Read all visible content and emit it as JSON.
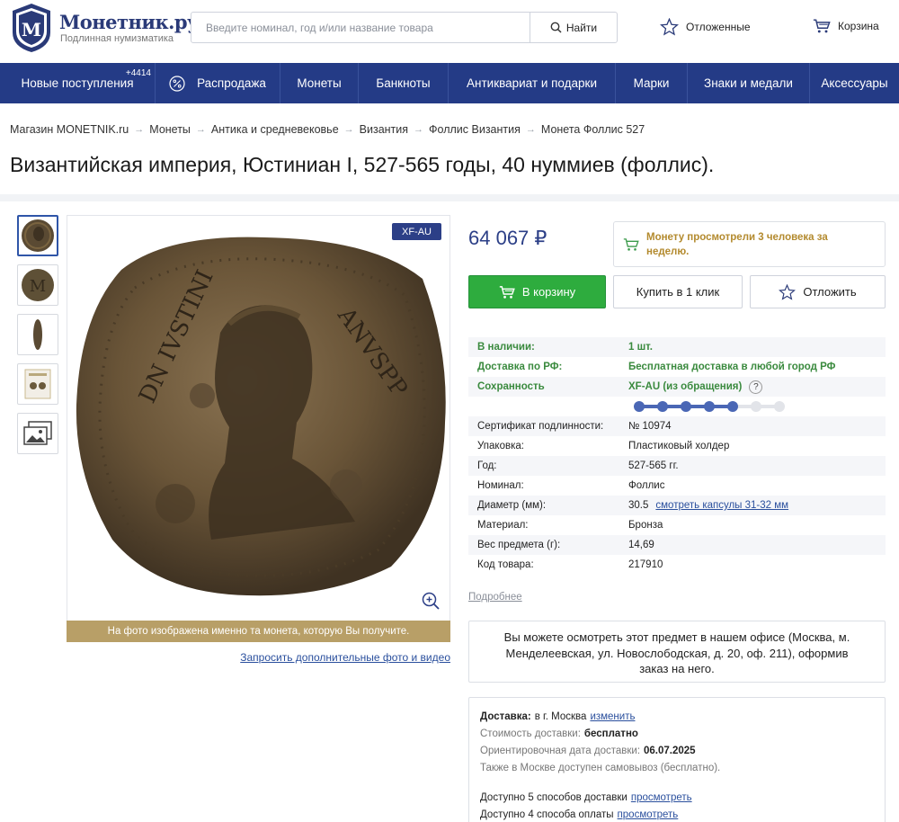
{
  "header": {
    "logo_title": "Монетник.ру",
    "logo_subtitle": "Подлинная нумизматика",
    "search_placeholder": "Введите номинал, год и/или название товара",
    "search_button": "Найти",
    "favorites_label": "Отложенные",
    "cart_label": "Корзина"
  },
  "nav": {
    "new_arrivals": "Новые поступления",
    "new_arrivals_count": "+4414",
    "sale": "Распродажа",
    "coins": "Монеты",
    "banknotes": "Банкноты",
    "antiques": "Антиквариат и подарки",
    "stamps": "Марки",
    "medals": "Знаки и медали",
    "accessories": "Аксессуары"
  },
  "breadcrumb": [
    "Магазин MONETNIK.ru",
    "Монеты",
    "Антика и средневековье",
    "Византия",
    "Фоллис Византия",
    "Монета Фоллис 527"
  ],
  "product": {
    "title": "Византийская империя, Юстиниан I, 527-565 годы, 40 нуммиев (фоллис).",
    "grade_badge": "XF-AU",
    "photo_note": "На фото изображена именно та монета, которую Вы получите.",
    "request_link": "Запросить дополнительные фото и видео",
    "price": "64 067 ₽",
    "viewers_text": "Монету просмотрели 3 человека за неделю.",
    "add_to_cart": "В корзину",
    "buy_one_click": "Купить в 1 клик",
    "defer": "Отложить",
    "grade_scale_level": 5,
    "grade_scale_total": 7
  },
  "specs": {
    "availability": {
      "label": "В наличии:",
      "value": "1 шт."
    },
    "shipping": {
      "label": "Доставка по РФ:",
      "value": "Бесплатная доставка в любой город РФ"
    },
    "condition": {
      "label": "Сохранность",
      "value": "XF-AU (из обращения)",
      "help": "?"
    },
    "rows": [
      {
        "label": "Сертификат подлинности:",
        "value": "№ 10974"
      },
      {
        "label": "Упаковка:",
        "value": "Пластиковый холдер"
      },
      {
        "label": "Год:",
        "value": "527-565 гг."
      },
      {
        "label": "Номинал:",
        "value": "Фоллис"
      },
      {
        "label": "Диаметр (мм):",
        "value": "30.5",
        "link": "смотреть капсулы 31-32 мм"
      },
      {
        "label": "Материал:",
        "value": "Бронза"
      },
      {
        "label": "Вес предмета (г):",
        "value": "14,69"
      },
      {
        "label": "Код товара:",
        "value": "217910"
      }
    ],
    "more_link": "Подробнее"
  },
  "office_text": "Вы можете осмотреть этот предмет в нашем офисе (Москва, м. Менделеевская, ул. Новослободская, д. 20, оф. 211), оформив заказ на него.",
  "delivery": {
    "label": "Доставка:",
    "city": "в г. Москва",
    "change_link": "изменить",
    "cost_label": "Стоимость доставки:",
    "cost_value": "бесплатно",
    "date_label": "Ориентировочная дата доставки:",
    "date_value": "06.07.2025",
    "pickup_note": "Также в Москве доступен самовывоз (бесплатно).",
    "methods_text": "Доступно 5 способов доставки",
    "methods_link": "просмотреть",
    "payment_text": "Доступно 4 способа оплаты",
    "payment_link": "просмотреть"
  },
  "colors": {
    "brand_blue": "#243b86",
    "cart_green": "#2eac3e",
    "availability_green": "#3a8a3e",
    "viewers_gold": "#b38a2e",
    "photo_note_bg": "#b89f67"
  }
}
